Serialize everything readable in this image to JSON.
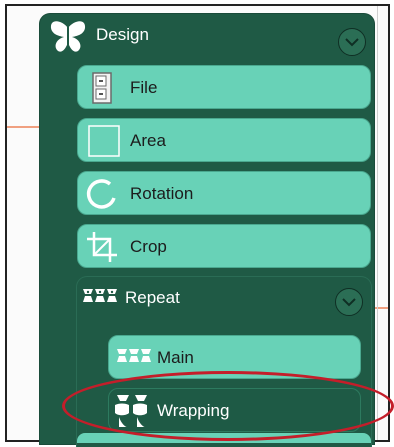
{
  "panel": {
    "title": "Design",
    "icon": "butterfly-icon",
    "toggle_icon": "chevron-down-icon",
    "items": [
      {
        "label": "File",
        "icon": "file-cabinet-icon"
      },
      {
        "label": "Area",
        "icon": "square-icon"
      },
      {
        "label": "Rotation",
        "icon": "rotation-icon"
      },
      {
        "label": "Crop",
        "icon": "crop-icon"
      }
    ],
    "repeat": {
      "title": "Repeat",
      "icon": "repeat-pattern-icon",
      "toggle_icon": "chevron-down-icon",
      "items": [
        {
          "label": "Main",
          "icon": "pattern-icon"
        },
        {
          "label": "Wrapping",
          "icon": "wrapping-icon",
          "selected": true
        }
      ]
    }
  },
  "colors": {
    "panel_bg": "#1f5a45",
    "item_bg": "#68d2b7",
    "highlight": "#c41e2a",
    "accent_line": "#f0a080"
  }
}
